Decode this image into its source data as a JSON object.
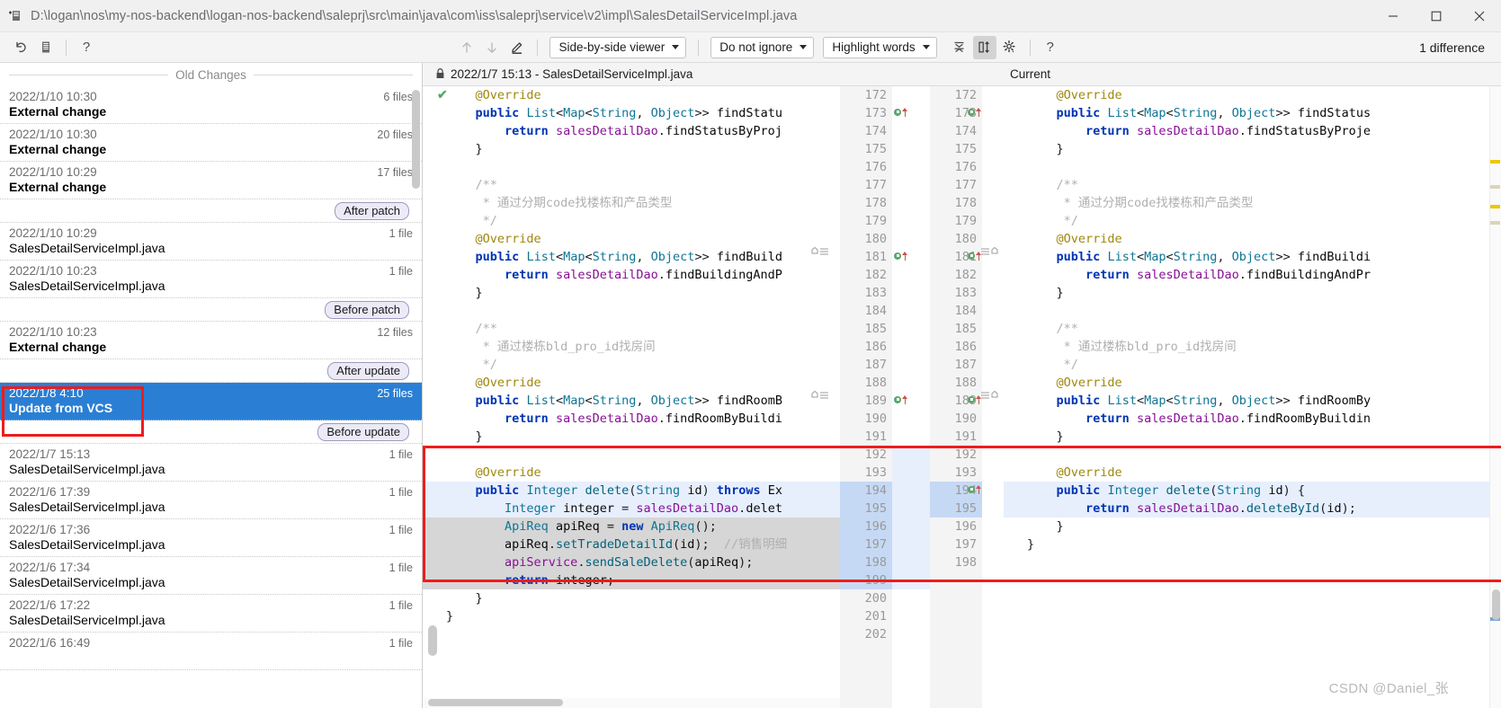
{
  "window": {
    "title": "D:\\logan\\nos\\my-nos-backend\\logan-nos-backend\\saleprj\\src\\main\\java\\com\\iss\\saleprj\\service\\v2\\impl\\SalesDetailServiceImpl.java",
    "app_icon": "diff-window-icon",
    "minimize": "─",
    "maximize": "☐",
    "close": "✕"
  },
  "toolbar": {
    "undo_icon": "undo-icon",
    "annotate_icon": "annotate-icon",
    "help_icon": "?",
    "prev_diff_icon": "↑",
    "next_diff_icon": "↓",
    "edit_icon": "edit-pencil-icon",
    "viewer_mode": "Side-by-side viewer",
    "ignore_mode": "Do not ignore",
    "highlight_mode": "Highlight words",
    "collapse_icon": "collapse-unchanged-icon",
    "sync_scroll_icon": "synchronize-scroll-icon",
    "settings_icon": "gear-icon",
    "toolbar_help_icon": "?",
    "difference_count": "1 difference"
  },
  "changes_panel": {
    "header": "Old Changes",
    "rows": [
      {
        "kind": "change",
        "date": "2022/1/10 10:30",
        "files": "6 files",
        "name": "External change",
        "bold": true,
        "selected": false
      },
      {
        "kind": "change",
        "date": "2022/1/10 10:30",
        "files": "20 files",
        "name": "External change",
        "bold": true,
        "selected": false
      },
      {
        "kind": "change",
        "date": "2022/1/10 10:29",
        "files": "17 files",
        "name": "External change",
        "bold": true,
        "selected": false
      },
      {
        "kind": "label",
        "label": "After patch"
      },
      {
        "kind": "change",
        "date": "2022/1/10 10:29",
        "files": "1 file",
        "name": "SalesDetailServiceImpl.java",
        "bold": false,
        "selected": false
      },
      {
        "kind": "change",
        "date": "2022/1/10 10:23",
        "files": "1 file",
        "name": "SalesDetailServiceImpl.java",
        "bold": false,
        "selected": false
      },
      {
        "kind": "label",
        "label": "Before patch"
      },
      {
        "kind": "change",
        "date": "2022/1/10 10:23",
        "files": "12 files",
        "name": "External change",
        "bold": true,
        "selected": false
      },
      {
        "kind": "label",
        "label": "After update"
      },
      {
        "kind": "change",
        "date": "2022/1/8 4:10",
        "files": "25 files",
        "name": "Update from VCS",
        "bold": true,
        "selected": true
      },
      {
        "kind": "label",
        "label": "Before update"
      },
      {
        "kind": "change",
        "date": "2022/1/7 15:13",
        "files": "1 file",
        "name": "SalesDetailServiceImpl.java",
        "bold": false,
        "selected": false
      },
      {
        "kind": "change",
        "date": "2022/1/6 17:39",
        "files": "1 file",
        "name": "SalesDetailServiceImpl.java",
        "bold": false,
        "selected": false
      },
      {
        "kind": "change",
        "date": "2022/1/6 17:36",
        "files": "1 file",
        "name": "SalesDetailServiceImpl.java",
        "bold": false,
        "selected": false
      },
      {
        "kind": "change",
        "date": "2022/1/6 17:34",
        "files": "1 file",
        "name": "SalesDetailServiceImpl.java",
        "bold": false,
        "selected": false
      },
      {
        "kind": "change",
        "date": "2022/1/6 17:22",
        "files": "1 file",
        "name": "SalesDetailServiceImpl.java",
        "bold": false,
        "selected": false
      },
      {
        "kind": "change",
        "date": "2022/1/6 16:49",
        "files": "1 file",
        "name": "",
        "bold": false,
        "selected": false
      }
    ]
  },
  "diff": {
    "left_header": "2022/1/7 15:13 - SalesDetailServiceImpl.java",
    "left_header_icon": "lock-icon",
    "right_header": "Current",
    "accepted_icon": "✔",
    "chevron_icon": "≫",
    "left_line_numbers": [
      "172",
      "173",
      "174",
      "175",
      "176",
      "177",
      "178",
      "179",
      "180",
      "181",
      "182",
      "183",
      "184",
      "185",
      "186",
      "187",
      "188",
      "189",
      "190",
      "191",
      "192",
      "193",
      "194",
      "195",
      "196",
      "197",
      "198",
      "199",
      "200",
      "201",
      "202"
    ],
    "right_line_numbers": [
      "172",
      "173",
      "174",
      "175",
      "176",
      "177",
      "178",
      "179",
      "180",
      "181",
      "182",
      "183",
      "184",
      "185",
      "186",
      "187",
      "188",
      "189",
      "190",
      "191",
      "192",
      "193",
      "194",
      "195",
      "196",
      "197",
      "198"
    ],
    "left_lines": [
      "    @Override",
      "    public List<Map<String, Object>> findStatu",
      "        return salesDetailDao.findStatusByProj",
      "    }",
      "",
      "    /**",
      "     * 通过分期code找楼栋和产品类型",
      "     */",
      "    @Override",
      "    public List<Map<String, Object>> findBuild",
      "        return salesDetailDao.findBuildingAndP",
      "    }",
      "",
      "    /**",
      "     * 通过楼栋bld_pro_id找房间",
      "     */",
      "    @Override",
      "    public List<Map<String, Object>> findRoomB",
      "        return salesDetailDao.findRoomByBuildi",
      "    }",
      "",
      "    @Override",
      "    public Integer delete(String id) throws Ex",
      "        Integer integer = salesDetailDao.delet",
      "        ApiReq apiReq = new ApiReq();",
      "        apiReq.setTradeDetailId(id);  //销售明细",
      "        apiService.sendSaleDelete(apiReq);",
      "        return integer;",
      "    }",
      "}",
      ""
    ],
    "right_lines": [
      "    @Override",
      "    public List<Map<String, Object>> findStatus",
      "        return salesDetailDao.findStatusByProje",
      "    }",
      "",
      "    /**",
      "     * 通过分期code找楼栋和产品类型",
      "     */",
      "    @Override",
      "    public List<Map<String, Object>> findBuildi",
      "        return salesDetailDao.findBuildingAndPr",
      "    }",
      "",
      "    /**",
      "     * 通过楼栋bld_pro_id找房间",
      "     */",
      "    @Override",
      "    public List<Map<String, Object>> findRoomBy",
      "        return salesDetailDao.findRoomByBuildin",
      "    }",
      "",
      "    @Override",
      "    public Integer delete(String id) {",
      "        return salesDetailDao.deleteById(id);",
      "    }",
      "}",
      ""
    ]
  },
  "watermark": "CSDN @Daniel_张",
  "colors": {
    "selection_blue": "#2a7fd4",
    "annotation_red": "#ee1c1c",
    "added_green": "#59a869",
    "modified_blue": "#e7effd",
    "deleted_gray": "#d6d6d6",
    "keyword_blue": "#0033b3",
    "annotation_yellow": "#9e880d",
    "field_purple": "#871094"
  }
}
